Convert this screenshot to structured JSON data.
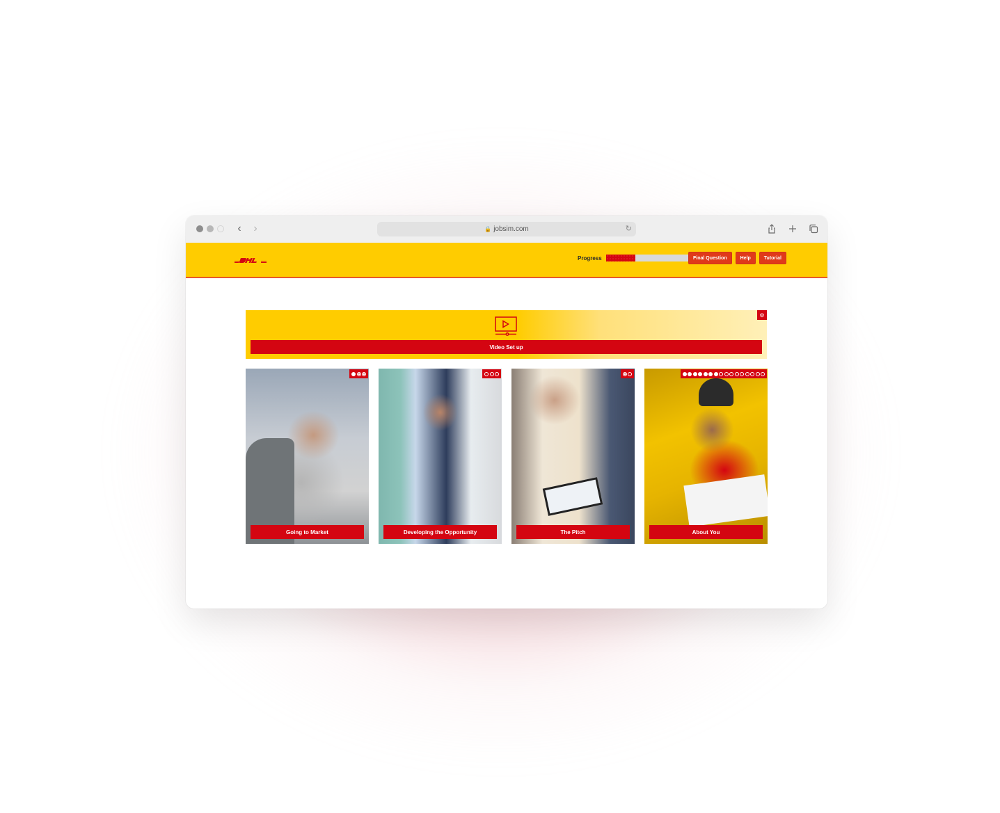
{
  "browser": {
    "url": "jobsim.com",
    "icons": {
      "back": "chevron-left-icon",
      "forward": "chevron-right-icon",
      "lock": "lock-icon",
      "reload": "reload-icon",
      "share": "share-icon",
      "new_tab": "plus-icon",
      "tabs": "tabs-overview-icon"
    }
  },
  "header": {
    "logo_text": "DHL",
    "progress_label": "Progress",
    "progress_fraction": 0.36,
    "buttons": [
      "Final Question",
      "Help",
      "Tutorial"
    ],
    "colors": {
      "brand_yellow": "#ffcc00",
      "brand_red": "#d40511",
      "button_orange": "#e0391a"
    }
  },
  "video_banner": {
    "label": "Video Set up",
    "icon": "video-play-icon",
    "settings_icon": "settings-icon"
  },
  "cards": [
    {
      "label": "Going to Market",
      "progress": [
        "done",
        "active",
        "active"
      ]
    },
    {
      "label": "Developing the Opportunity",
      "progress": [
        "todo",
        "todo",
        "todo"
      ]
    },
    {
      "label": "The Pitch",
      "progress": [
        "active",
        "todo"
      ]
    },
    {
      "label": "About You",
      "progress": [
        "done",
        "done",
        "done",
        "done",
        "done",
        "done",
        "done",
        "todo",
        "todo",
        "todo",
        "todo",
        "todo",
        "todo",
        "todo",
        "todo",
        "todo"
      ]
    }
  ]
}
